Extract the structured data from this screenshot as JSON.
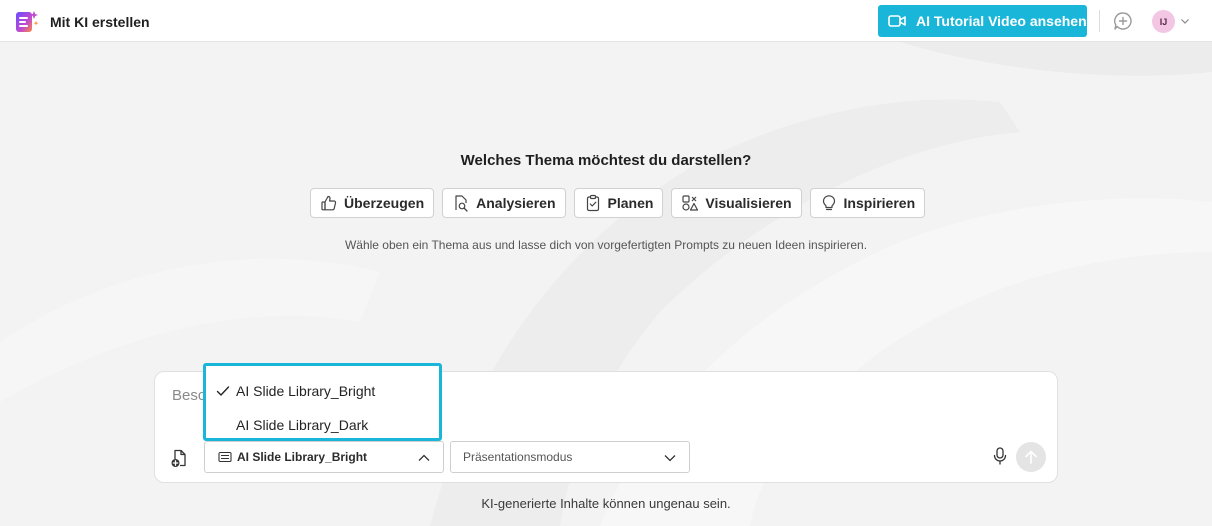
{
  "header": {
    "title": "Mit KI erstellen",
    "tutorial_label": "AI Tutorial Video ansehen",
    "avatar_initials": "IJ",
    "accent_color": "#1ab6d9"
  },
  "main": {
    "question": "Welches Thema möchtest du darstellen?",
    "topics": [
      {
        "label": "Überzeugen",
        "icon": "thumbs-up-icon"
      },
      {
        "label": "Analysieren",
        "icon": "document-search-icon"
      },
      {
        "label": "Planen",
        "icon": "clipboard-check-icon"
      },
      {
        "label": "Visualisieren",
        "icon": "shapes-icon"
      },
      {
        "label": "Inspirieren",
        "icon": "lightbulb-icon"
      }
    ],
    "hint": "Wähle oben ein Thema aus und lasse dich von vorgefertigten Prompts zu neuen Ideen inspirieren."
  },
  "composer": {
    "placeholder": "Beschreibe, was du erstellen möchtest.",
    "library_selected": "AI Slide Library_Bright",
    "mode_placeholder": "Präsentationsmodus"
  },
  "dropdown": {
    "options": [
      {
        "label": "AI Slide Library_Bright",
        "selected": true
      },
      {
        "label": "AI Slide Library_Dark",
        "selected": false
      }
    ]
  },
  "footer": {
    "note": "KI-generierte Inhalte können ungenau sein."
  }
}
